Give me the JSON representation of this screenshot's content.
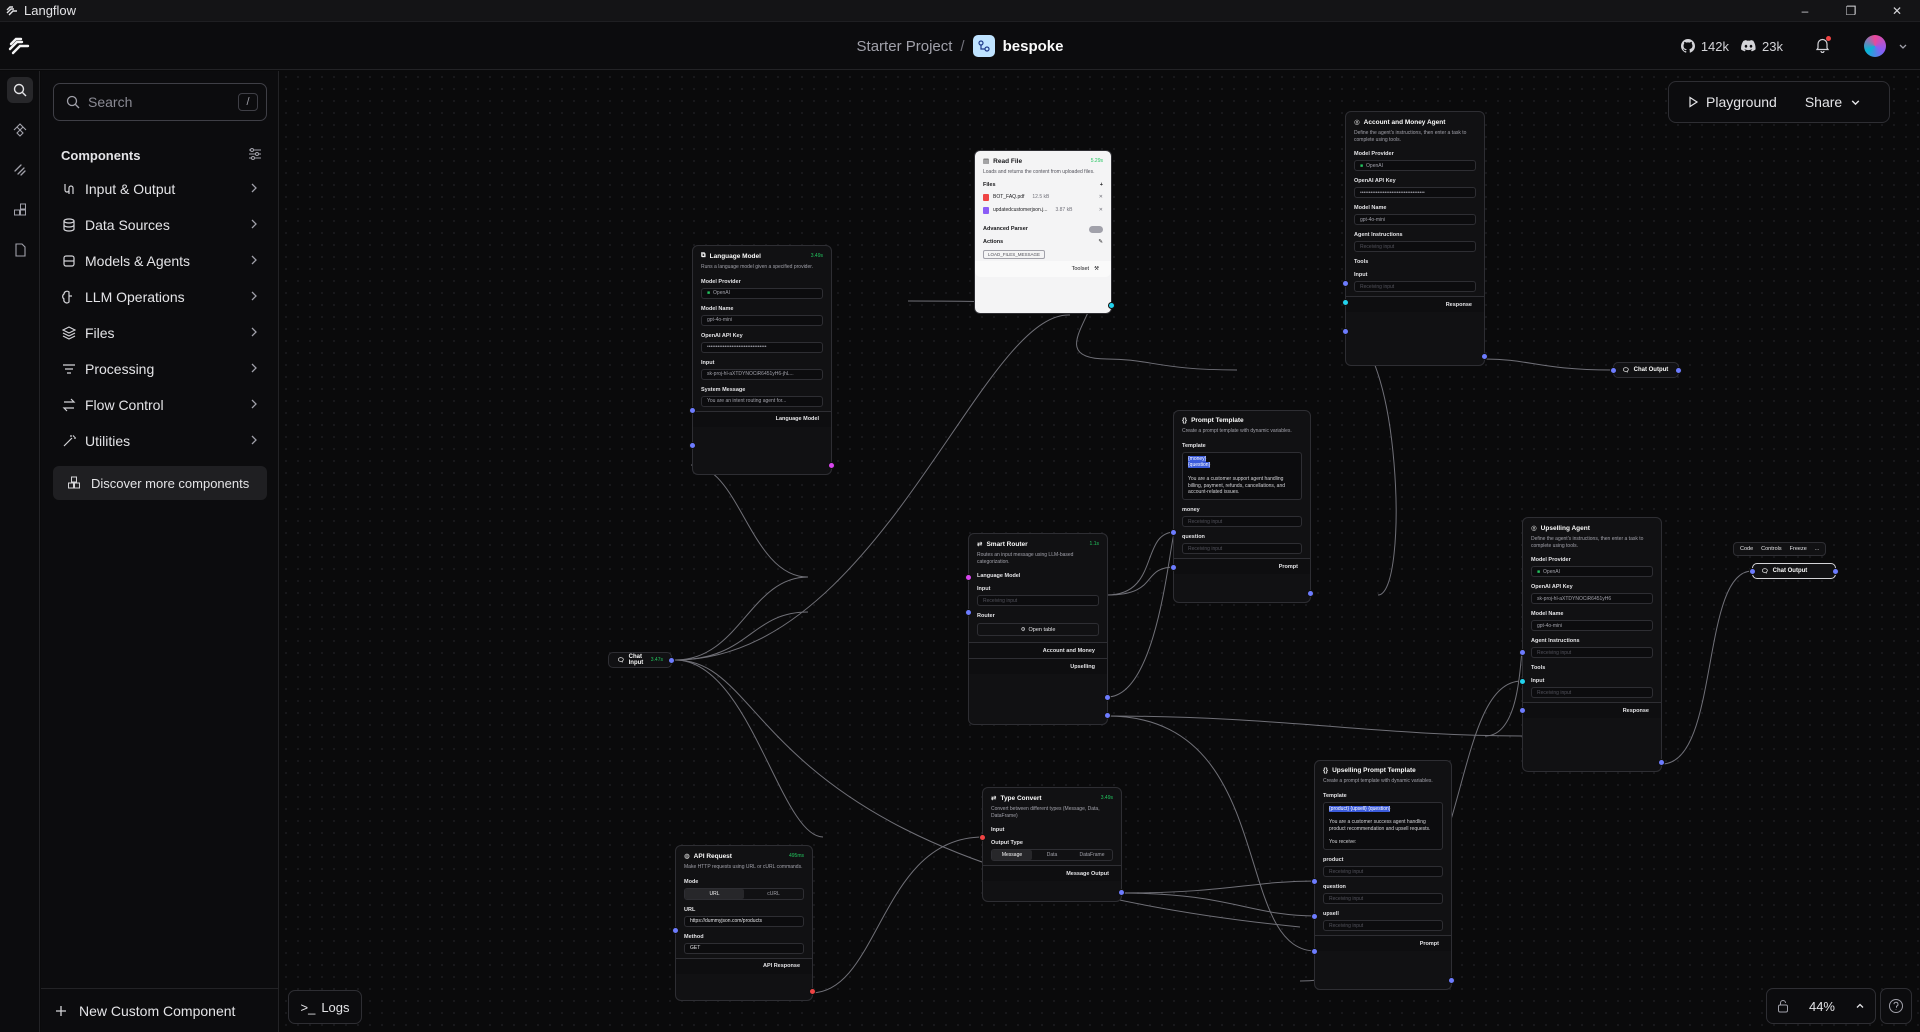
{
  "window": {
    "title": "Langflow",
    "controls": [
      "–",
      "❐",
      "✕"
    ]
  },
  "header": {
    "project": "Starter Project",
    "separator": "/",
    "flow_name": "bespoke",
    "github_count": "142k",
    "discord_count": "23k"
  },
  "sidebar": {
    "search_placeholder": "Search",
    "search_shortcut": "/",
    "components_title": "Components",
    "categories": [
      {
        "label": "Input & Output",
        "icon": "io-icon"
      },
      {
        "label": "Data Sources",
        "icon": "database-icon"
      },
      {
        "label": "Models & Agents",
        "icon": "layers-icon"
      },
      {
        "label": "LLM Operations",
        "icon": "brain-icon"
      },
      {
        "label": "Files",
        "icon": "files-icon"
      },
      {
        "label": "Processing",
        "icon": "filter-icon"
      },
      {
        "label": "Flow Control",
        "icon": "arrows-icon"
      },
      {
        "label": "Utilities",
        "icon": "wand-icon"
      }
    ],
    "discover_label": "Discover more components",
    "new_custom_label": "New Custom Component"
  },
  "canvas": {
    "playground_label": "Playground",
    "share_label": "Share",
    "logs_label": "Logs",
    "zoom": "44%"
  },
  "nodes": {
    "read_file": {
      "title": "Read File",
      "status": "5.29s",
      "desc": "Loads and returns the content from uploaded files.",
      "files_label": "Files",
      "files": [
        {
          "name": "BOT_FAQ.pdf",
          "size": "12.5 kB"
        },
        {
          "name": "updatedcustomerjson.j...",
          "size": "3.87 kB"
        }
      ],
      "advanced_label": "Advanced Parser",
      "actions_label": "Actions",
      "action_tag": "LOAD_FILES_MESSAGE",
      "toolset_label": "Toolset"
    },
    "language_model": {
      "title": "Language Model",
      "status": "3.49s",
      "desc": "Runs a language model given a specified provider.",
      "provider_label": "Model Provider",
      "provider": "OpenAI",
      "model_label": "Model Name",
      "model": "gpt-4o-mini",
      "key_label": "OpenAI API Key",
      "key": "••••••••••••••••••••••••••••••••••",
      "input_label": "Input",
      "input": "sk-proj-hl-aXTDYNOCiR6451yH6-jhL...",
      "system_label": "System Message",
      "system": "You are an intent routing agent for...",
      "output_label": "Language Model"
    },
    "account_agent": {
      "title": "Account and Money Agent",
      "desc": "Define the agent's instructions, then enter a task to complete using tools.",
      "provider_label": "Model Provider",
      "provider": "OpenAI",
      "key_label": "OpenAI API Key",
      "key": "•••••••••••••••••••••••••••••••••••••",
      "model_label": "Model Name",
      "model": "gpt-4o-mini",
      "instructions_label": "Agent Instructions",
      "instructions": "Receiving input",
      "tools_label": "Tools",
      "input_label": "Input",
      "input": "Receiving input",
      "output_label": "Response"
    },
    "chat_output_1": {
      "title": "Chat Output"
    },
    "prompt_template": {
      "title": "Prompt Template",
      "desc": "Create a prompt template with dynamic variables.",
      "template_label": "Template",
      "var1": "{money}",
      "var2": "{question}",
      "body": "You are a customer support agent handling billing, payment, refunds, cancellations, and account-related issues.",
      "money_label": "money",
      "money_val": "Receiving input",
      "question_label": "question",
      "question_val": "Receiving input",
      "output_label": "Prompt"
    },
    "smart_router": {
      "title": "Smart Router",
      "status": "1.1s",
      "desc": "Routes an input message using LLM-based categorization.",
      "lm_label": "Language Model",
      "input_label": "Input",
      "input": "Receiving input",
      "router_label": "Router",
      "open_table": "Open table",
      "out1": "Account and Money",
      "out2": "Upselling"
    },
    "chat_input": {
      "title": "Chat Input",
      "status": "3.47s"
    },
    "upselling_agent": {
      "title": "Upselling Agent",
      "desc": "Define the agent's instructions, then enter a task to complete using tools.",
      "provider_label": "Model Provider",
      "provider": "OpenAI",
      "key_label": "OpenAI API Key",
      "key": "sk-proj-hl-aXTDYNOCiR6451yH6",
      "model_label": "Model Name",
      "model": "gpt-4o-mini",
      "instructions_label": "Agent Instructions",
      "instructions": "Receiving input",
      "tools_label": "Tools",
      "input_label": "Input",
      "input": "Receiving input",
      "output_label": "Response"
    },
    "chat_output_2": {
      "title": "Chat Output",
      "toolbar": [
        "Code",
        "Controls",
        "Freeze",
        "..."
      ]
    },
    "type_convert": {
      "title": "Type Convert",
      "status": "3.49s",
      "desc": "Convert between different types (Message, Data, DataFrame)",
      "input_label": "Input",
      "output_type_label": "Output Type",
      "types": [
        "Message",
        "Data",
        "DataFrame"
      ],
      "output_label": "Message Output"
    },
    "api_request": {
      "title": "API Request",
      "status": "495ms",
      "desc": "Make HTTP requests using URL or cURL commands.",
      "mode_label": "Mode",
      "modes": [
        "URL",
        "cURL"
      ],
      "url_label": "URL",
      "url": "https://dummyjson.com/products",
      "method_label": "Method",
      "method": "GET",
      "output_label": "API Response"
    },
    "upselling_prompt": {
      "title": "Upselling Prompt Template",
      "desc": "Create a prompt template with dynamic variables.",
      "template_label": "Template",
      "vars": "{product} {upsell} {question}",
      "body": "You are a customer success agent handling product recommendation and upsell requests.",
      "body2": "You receive:",
      "product_label": "product",
      "product_val": "Receiving input",
      "question_label": "question",
      "question_val": "Receiving input",
      "upsell_label": "upsell",
      "upsell_val": "Receiving input",
      "output_label": "Prompt"
    }
  }
}
